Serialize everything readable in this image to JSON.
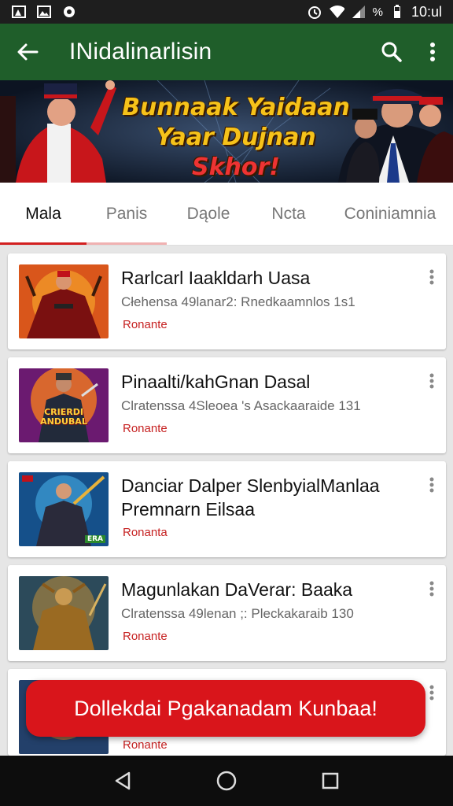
{
  "status_bar": {
    "time": "10:ul",
    "percent": "%"
  },
  "app_bar": {
    "title": "INidalinarlisin"
  },
  "banner": {
    "line1": "Bunnaak Yaidaan",
    "line2_main": "Yaar Dujnan ",
    "line2_red": "Skhor!"
  },
  "tabs": [
    {
      "label": "Mala"
    },
    {
      "label": "Panis"
    },
    {
      "label": "Dąole"
    },
    {
      "label": "Ncta"
    },
    {
      "label": "Coniniamnia"
    }
  ],
  "items": [
    {
      "title": "Rarlcarl Iaakldarh Uasa",
      "subtitle": "Cłehensa 49lanar2: Rnedkaamnlos 1s1",
      "tag": "Ronante"
    },
    {
      "title": "Pinaalti/kahGnan Dasal",
      "subtitle": "Clratenssa 4Sleoea 's Asackaaraide 131",
      "tag": "Ronante"
    },
    {
      "title": "Danciar Dalper SlenbyialManlaa Premnarn Eilsaa",
      "subtitle": "",
      "tag": "Ronanta"
    },
    {
      "title": "Magunlakan DaVerar: Baaka",
      "subtitle": "Clratenssa 49lenan ;: Pleckakaraib 130",
      "tag": "Ronante"
    },
    {
      "title": "",
      "subtitle": "",
      "tag": "Ronante"
    }
  ],
  "thumb_captions": {
    "item2": "CRIERDI ANDUBAL",
    "item3_badge": "ERA"
  },
  "cta": {
    "label": "Dollekdai Pgakanadam Kunbaa!"
  },
  "colors": {
    "app_bar": "#1f5e2a",
    "accent": "#d32020",
    "cta": "#d9151b"
  }
}
